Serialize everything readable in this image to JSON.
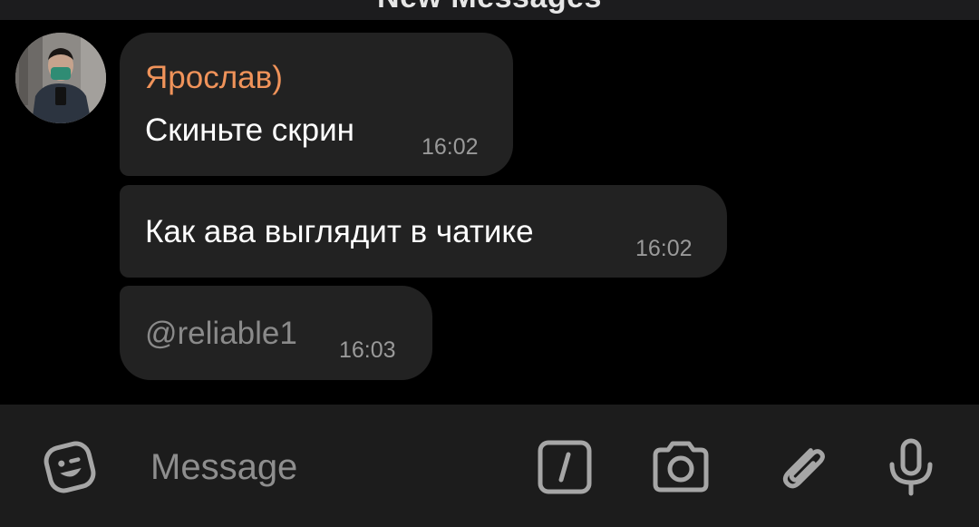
{
  "banner": {
    "label": "New Messages"
  },
  "chat": {
    "sender_name": "Ярослав)",
    "messages": [
      {
        "text": "Скиньте скрин",
        "time": "16:02"
      },
      {
        "text": "Как ава выглядит в чатике",
        "time": "16:02"
      },
      {
        "text": "@reliable1",
        "time": "16:03"
      }
    ]
  },
  "composer": {
    "placeholder": "Message",
    "icons": [
      "emoji-icon",
      "commands-icon",
      "camera-icon",
      "attach-icon",
      "microphone-icon"
    ]
  },
  "colors": {
    "background": "#000000",
    "bubble": "#222222",
    "sender_name": "#f0935a",
    "timestamp": "#9a9a9a",
    "composer_bar": "#1c1c1c",
    "icon": "#a6a6a6"
  }
}
